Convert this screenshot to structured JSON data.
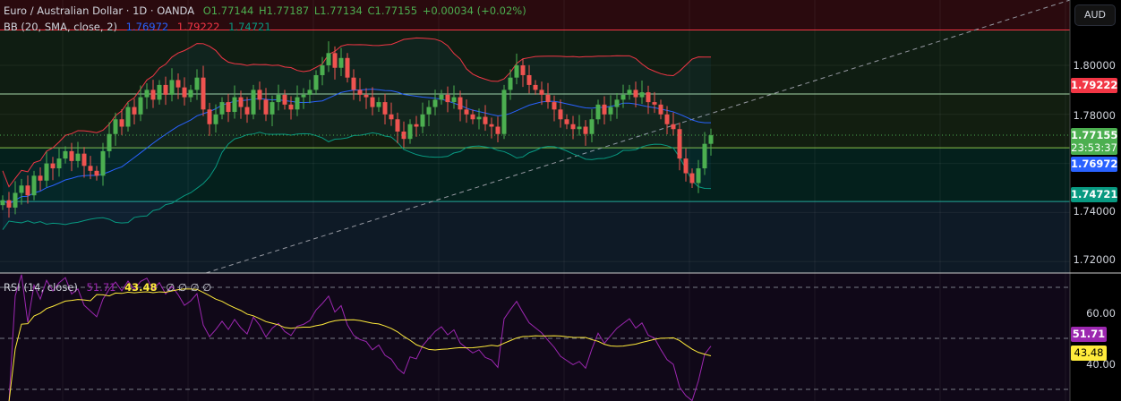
{
  "header": {
    "symbol": "Euro / Australian Dollar · 1D · OANDA",
    "open": "O1.77144",
    "high": "H1.77187",
    "low": "L1.77134",
    "close": "C1.77155",
    "change": "+0.00034 (+0.02%)"
  },
  "bb_legend": {
    "label": "BB (20, SMA, close, 2)",
    "basis": "1.76972",
    "upper": "1.79222",
    "lower": "1.74721"
  },
  "rsi_legend": {
    "label": "RSI (14, close)",
    "rsi": "51.71",
    "ma": "43.48",
    "extras": "∅ ∅ ∅ ∅"
  },
  "price_axis": {
    "currency": "AUD",
    "ticks": [
      "1.80000",
      "1.78000",
      "1.74000",
      "1.72000"
    ],
    "upper_tag": "1.79222",
    "last_price": "1.77155",
    "countdown": "23:53:37",
    "basis_tag": "1.76972",
    "lower_tag": "1.74721"
  },
  "rsi_axis": {
    "ticks": [
      "60.00",
      "40.00"
    ],
    "rsi_tag": "51.71",
    "ma_tag": "43.48"
  },
  "colors": {
    "up": "#26a69a",
    "up_bright": "#4caf50",
    "down": "#ef5350",
    "bb_upper": "#f23645",
    "bb_basis": "#2962ff",
    "bb_lower": "#089981",
    "rsi": "#9c27b0",
    "rsi_ma": "#ffeb3b"
  },
  "chart_data": {
    "type": "candlestick",
    "price_range": [
      1.7125,
      1.8266
    ],
    "levels": [
      1.8144,
      1.7883,
      1.7664,
      1.7445
    ],
    "closes": [
      1.745,
      1.742,
      1.748,
      1.751,
      1.747,
      1.755,
      1.753,
      1.76,
      1.758,
      1.762,
      1.765,
      1.761,
      1.764,
      1.759,
      1.757,
      1.755,
      1.765,
      1.772,
      1.778,
      1.775,
      1.783,
      1.78,
      1.787,
      1.79,
      1.786,
      1.792,
      1.788,
      1.794,
      1.791,
      1.787,
      1.79,
      1.795,
      1.782,
      1.776,
      1.78,
      1.785,
      1.781,
      1.787,
      1.783,
      1.78,
      1.79,
      1.786,
      1.78,
      1.785,
      1.788,
      1.784,
      1.782,
      1.787,
      1.788,
      1.79,
      1.796,
      1.8,
      1.805,
      1.799,
      1.803,
      1.795,
      1.79,
      1.788,
      1.787,
      1.783,
      1.785,
      1.78,
      1.778,
      1.773,
      1.77,
      1.776,
      1.775,
      1.78,
      1.783,
      1.786,
      1.788,
      1.785,
      1.787,
      1.782,
      1.78,
      1.778,
      1.779,
      1.776,
      1.775,
      1.772,
      1.79,
      1.795,
      1.8,
      1.796,
      1.792,
      1.79,
      1.788,
      1.785,
      1.782,
      1.778,
      1.776,
      1.774,
      1.775,
      1.772,
      1.778,
      1.784,
      1.78,
      1.783,
      1.786,
      1.788,
      1.79,
      1.787,
      1.789,
      1.785,
      1.784,
      1.78,
      1.776,
      1.774,
      1.762,
      1.756,
      1.752,
      1.758,
      1.768,
      1.7715
    ],
    "rsi_range": [
      20,
      80
    ]
  }
}
